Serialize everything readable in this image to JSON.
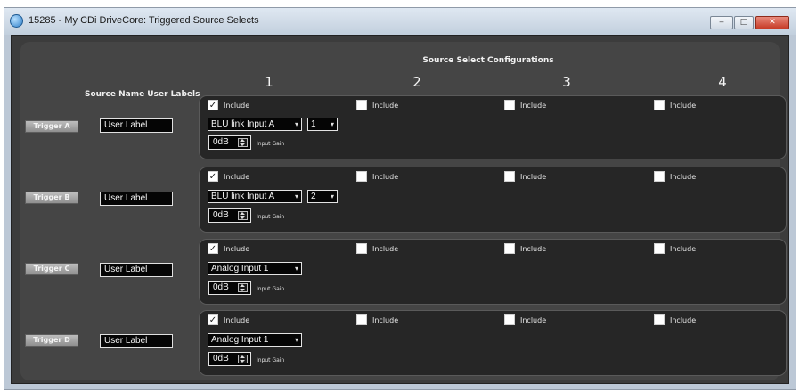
{
  "window": {
    "title": "15285 - My CDi DriveCore: Triggered Source Selects"
  },
  "header": {
    "title": "Source Select Configurations",
    "columns": [
      "1",
      "2",
      "3",
      "4"
    ],
    "labels_header": "Source Name User Labels"
  },
  "include_label": "Include",
  "gain_label": "Input Gain",
  "rows": [
    {
      "trigger": "Trigger A",
      "user_label": "User Label",
      "source": "BLU link Input A",
      "channel": "1",
      "gain": "0dB"
    },
    {
      "trigger": "Trigger B",
      "user_label": "User Label",
      "source": "BLU link Input A",
      "channel": "2",
      "gain": "0dB"
    },
    {
      "trigger": "Trigger C",
      "user_label": "User Label",
      "source": "Analog Input 1",
      "channel": "",
      "gain": "0dB"
    },
    {
      "trigger": "Trigger D",
      "user_label": "User Label",
      "source": "Analog Input 1",
      "channel": "",
      "gain": "0dB"
    }
  ]
}
